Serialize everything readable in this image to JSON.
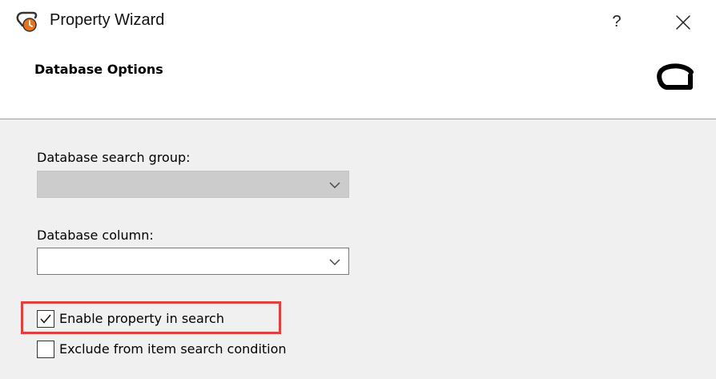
{
  "window": {
    "title": "Property Wizard",
    "help_label": "?",
    "icon": "property-wizard-app-icon",
    "close_icon": "close-icon"
  },
  "header": {
    "title": "Database Options",
    "logo": "brand-logo"
  },
  "fields": {
    "search_group": {
      "label": "Database search group:",
      "value": "",
      "enabled": false
    },
    "column": {
      "label": "Database column:",
      "value": "",
      "enabled": true
    }
  },
  "checkboxes": [
    {
      "label": "Enable property in search",
      "checked": true,
      "highlighted": true
    },
    {
      "label": "Exclude from item search condition",
      "checked": false,
      "highlighted": false
    }
  ],
  "colors": {
    "highlight": "#e0403e",
    "icon_orange": "#e8731a",
    "disabled_field": "#cccccc"
  }
}
